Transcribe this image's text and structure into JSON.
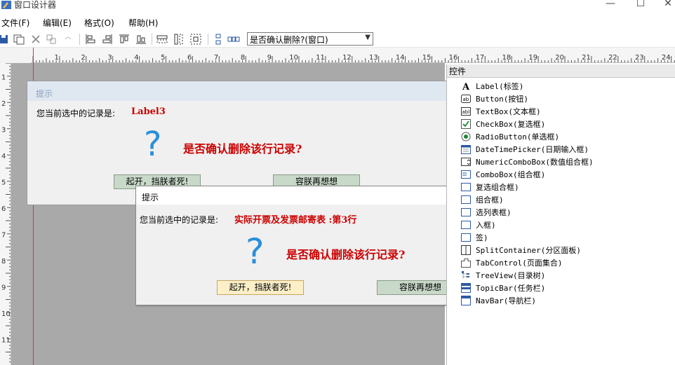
{
  "window": {
    "title": "窗口设计器",
    "min_glyph": "—",
    "max_glyph": "☐",
    "close_glyph": "✕"
  },
  "menu": {
    "items": [
      "文件(F)",
      "编辑(E)",
      "格式(O)",
      "帮助(H)"
    ]
  },
  "toolbar": {
    "combo_value": "是否确认删除?(窗口)"
  },
  "ruler": {
    "h_numbers": [
      "1",
      "2",
      "3",
      "4",
      "5",
      "6",
      "7",
      "8",
      "9",
      "10",
      "11",
      "12",
      "13",
      "14",
      "15",
      "16",
      "17",
      "18",
      "19",
      "20",
      "21",
      "22",
      "23",
      "24"
    ],
    "v_numbers": [
      "1",
      "2",
      "3",
      "4",
      "5",
      "6",
      "7",
      "8",
      "9",
      "10",
      "11"
    ]
  },
  "dialog_design": {
    "title": "提示",
    "record_label": "您当前选中的记录是:",
    "record_value": "Label3",
    "question_mark": "?",
    "question": "是否确认删除该行记录?",
    "btn_confirm": "起开，挡朕者死!",
    "btn_cancel": "容朕再想想"
  },
  "dialog_preview": {
    "title": "提示",
    "record_label": "您当前选中的记录是:",
    "record_value": "实际开票及发票邮寄表  :第3行",
    "question_mark": "?",
    "question": "是否确认删除该行记录?",
    "btn_confirm": "起开，挡朕者死!",
    "btn_cancel": "容朕再想想"
  },
  "controls_panel": {
    "title": "控件",
    "items": [
      {
        "label": "Label(标签)",
        "icon": "label-icon"
      },
      {
        "label": "Button(按钮)",
        "icon": "button-icon"
      },
      {
        "label": "TextBox(文本框)",
        "icon": "textbox-icon"
      },
      {
        "label": "CheckBox(复选框)",
        "icon": "checkbox-icon"
      },
      {
        "label": "RadioButton(单选框)",
        "icon": "radio-icon"
      },
      {
        "label": "DateTimePicker(日期输入框)",
        "icon": "calendar-icon"
      },
      {
        "label": "NumericComboBox(数值组合框)",
        "icon": "numeric-combo-icon"
      },
      {
        "label": "ComboBox(组合框)",
        "icon": "combobox-icon"
      },
      {
        "label": "复选组合框)",
        "icon": "multi-combo-icon"
      },
      {
        "label": "组合框)",
        "icon": "combo-icon"
      },
      {
        "label": "选列表框)",
        "icon": "list-icon"
      },
      {
        "label": "入框)",
        "icon": "input-icon"
      },
      {
        "label": "签)",
        "icon": "tag-icon"
      },
      {
        "label": "SplitContainer(分区面板)",
        "icon": "split-icon"
      },
      {
        "label": "TabControl(页面集合)",
        "icon": "tab-icon"
      },
      {
        "label": "TreeView(目录树)",
        "icon": "tree-icon"
      },
      {
        "label": "TopicBar(任务栏)",
        "icon": "topicbar-icon"
      },
      {
        "label": "NavBar(导航栏)",
        "icon": "navbar-icon"
      }
    ]
  },
  "colors": {
    "accent_red": "#cc0000",
    "question_blue": "#2a8fd8",
    "canvas_gray": "#a9a9a9",
    "button_green": "#c9d9c9",
    "button_yellow": "#fdf0c8"
  }
}
